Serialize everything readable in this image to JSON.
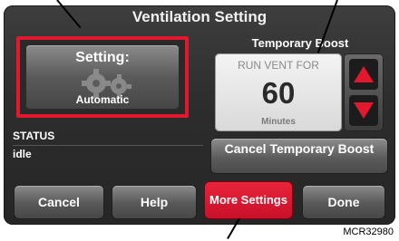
{
  "title": "Ventilation Setting",
  "setting": {
    "label": "Setting:",
    "value": "Automatic"
  },
  "status": {
    "label": "STATUS",
    "value": "idle"
  },
  "boost": {
    "heading": "Temporary Boost",
    "run_label": "RUN VENT FOR",
    "value": "60",
    "unit": "Minutes",
    "cancel_label": "Cancel Temporary Boost"
  },
  "footer": {
    "cancel": "Cancel",
    "help": "Help",
    "more": "More Settings",
    "done": "Done"
  },
  "figure_code": "MCR32980",
  "colors": {
    "accent": "#e2182f",
    "screen": "#333333",
    "button": "#6b6b6b"
  }
}
